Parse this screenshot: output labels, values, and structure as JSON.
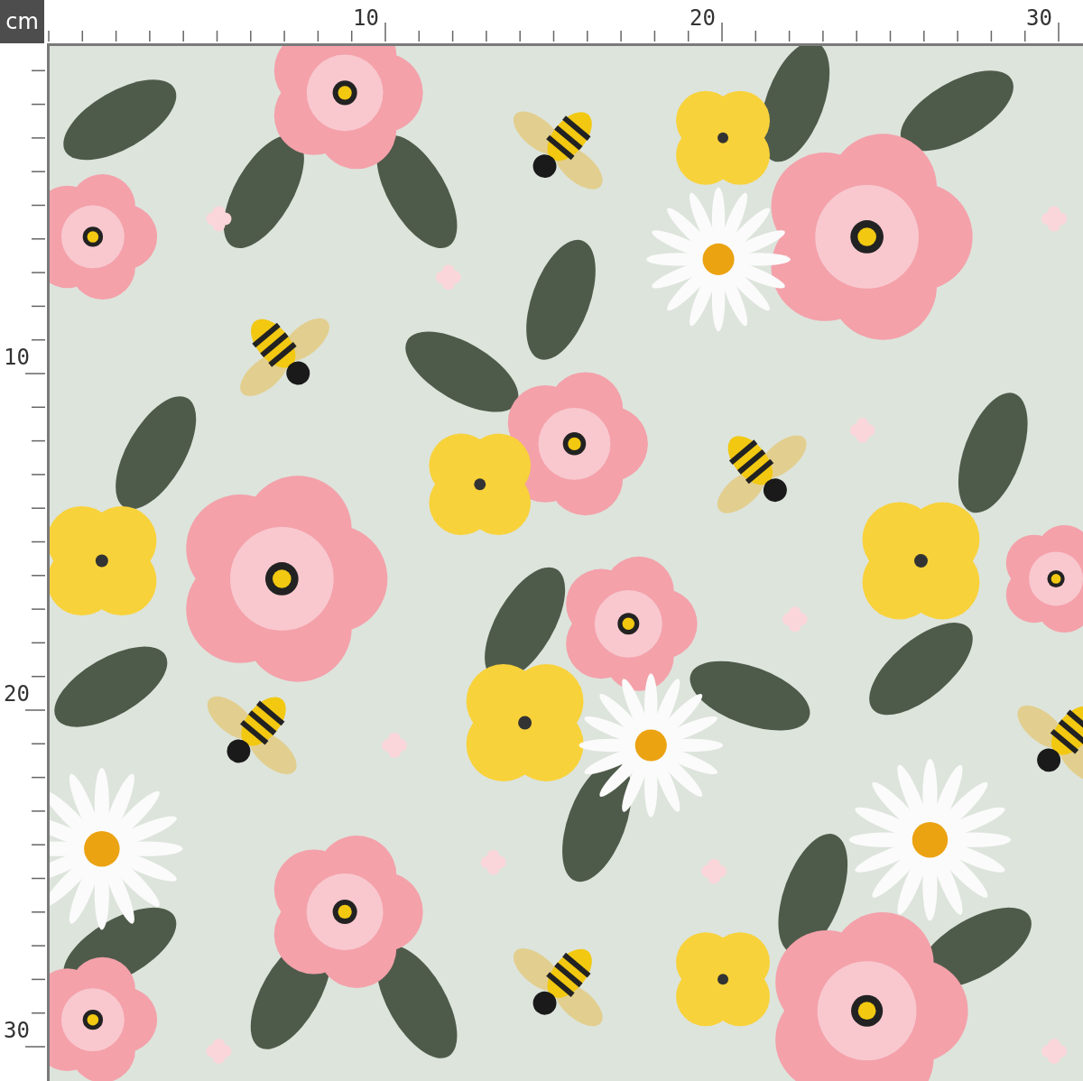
{
  "unit_label": "cm",
  "top_ruler": {
    "labels": [
      "10",
      "20",
      "30"
    ]
  },
  "left_ruler": {
    "labels": [
      "10",
      "20",
      "30"
    ]
  }
}
